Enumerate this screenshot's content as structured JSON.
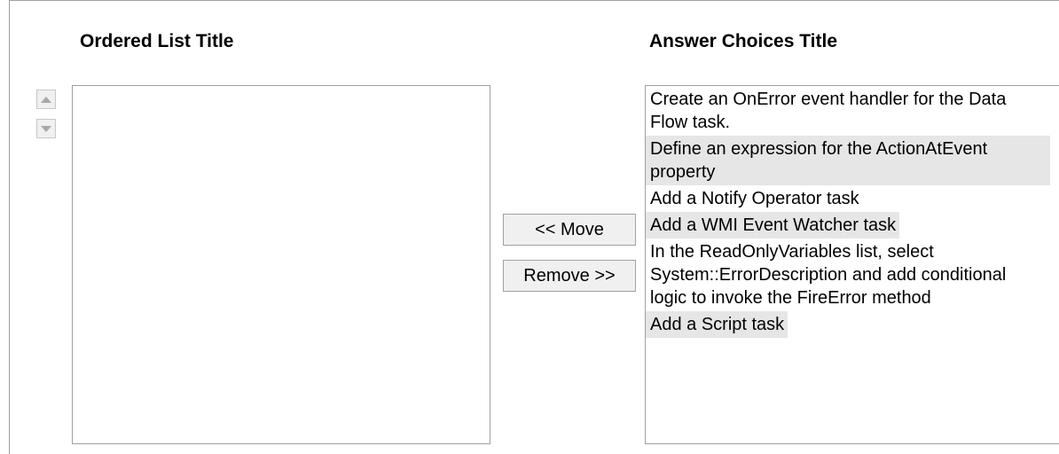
{
  "ordered_list": {
    "title": "Ordered List Title",
    "items": []
  },
  "answer_choices": {
    "title": "Answer Choices Title",
    "items": [
      {
        "label": "Create an OnError event handler for the Data Flow task.",
        "shaded": false
      },
      {
        "label": "Define an expression for the ActionAtEvent property",
        "shaded": true
      },
      {
        "label": "Add a Notify Operator task",
        "shaded": false
      },
      {
        "label": "Add a WMI Event Watcher task",
        "shaded": true
      },
      {
        "label": "In the ReadOnlyVariables list, select System::ErrorDescription and add conditional logic to invoke the FireError method",
        "shaded": false
      },
      {
        "label": "Add a Script task",
        "shaded": true
      }
    ]
  },
  "buttons": {
    "move_label": "<< Move",
    "remove_label": "Remove >>",
    "up_icon": "triangle-up-icon",
    "down_icon": "triangle-down-icon"
  },
  "colors": {
    "shaded_item_bg": "#e6e6e6",
    "border": "#a0a0a0",
    "button_bg": "#f0f0f0"
  }
}
